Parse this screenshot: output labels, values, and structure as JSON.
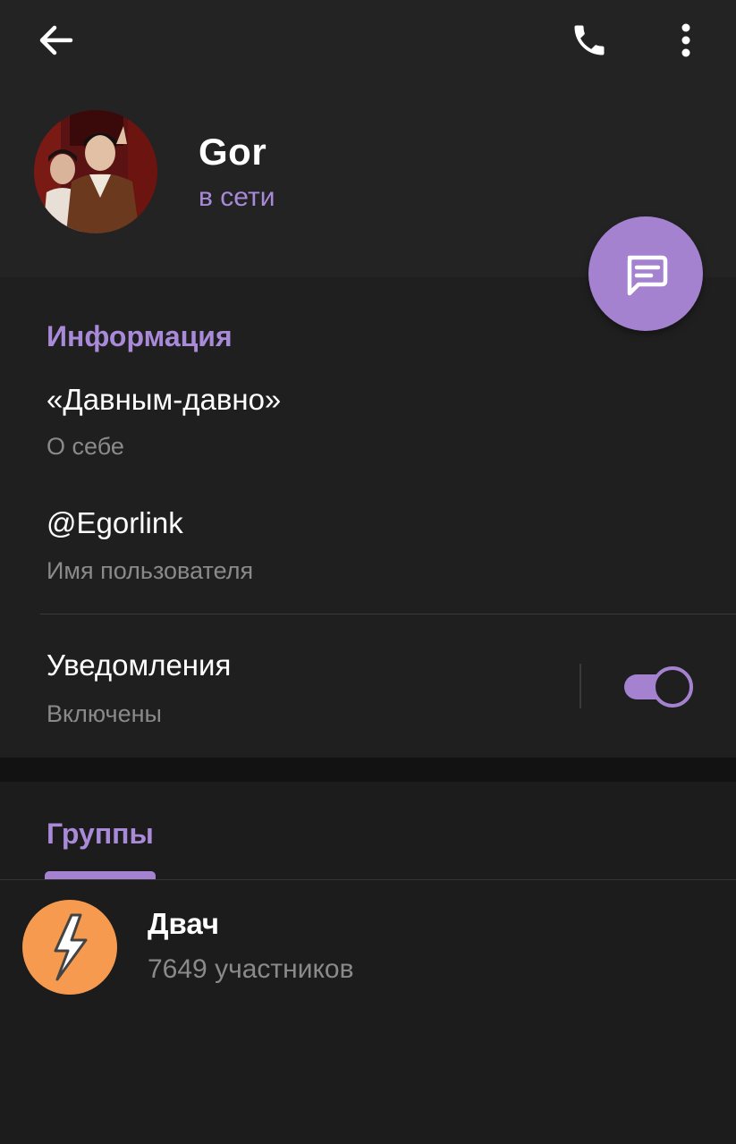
{
  "header": {
    "icons": {
      "back": "arrow-left-icon",
      "call": "phone-icon",
      "more": "more-vertical-icon"
    },
    "profile": {
      "name": "Gor",
      "status": "в сети"
    },
    "fab_icon": "message-icon"
  },
  "info": {
    "section_title": "Информация",
    "bio_value": "«Давным-давно»",
    "bio_label": "О себе",
    "username_value": "@Egorlink",
    "username_label": "Имя пользователя",
    "notifications_title": "Уведомления",
    "notifications_status": "Включены",
    "notifications_enabled": true
  },
  "groups": {
    "tab_label": "Группы",
    "items": [
      {
        "name": "Двач",
        "members": "7649 участников",
        "icon": "lightning-icon"
      }
    ]
  },
  "colors": {
    "accent": "#a482d0",
    "accent_text": "#a98ad8",
    "group_avatar": "#f69a4f",
    "background": "#1c1c1c",
    "header_background": "#232323"
  }
}
